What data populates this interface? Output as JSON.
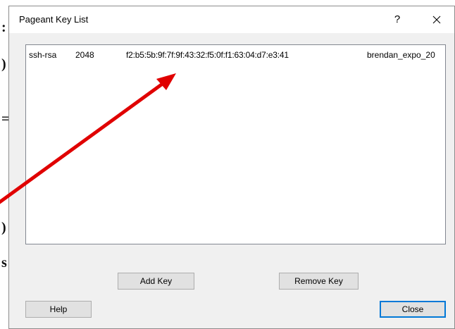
{
  "dialog": {
    "title": "Pageant Key List",
    "help_glyph": "?",
    "close_glyph": "×"
  },
  "keylist": {
    "rows": [
      {
        "type": "ssh-rsa",
        "bits": "2048",
        "fingerprint": "f2:b5:5b:9f:7f:9f:43:32:f5:0f:f1:63:04:d7:e3:41",
        "comment": "brendan_expo_20"
      }
    ]
  },
  "buttons": {
    "add_key": "Add Key",
    "remove_key": "Remove Key",
    "help": "Help",
    "close": "Close"
  },
  "annotation": {
    "arrow_color": "#e00000"
  },
  "colors": {
    "dialog_bg": "#f0f0f0",
    "titlebar_bg": "#ffffff",
    "button_bg": "#e1e1e1",
    "default_button_border": "#0078d7"
  }
}
